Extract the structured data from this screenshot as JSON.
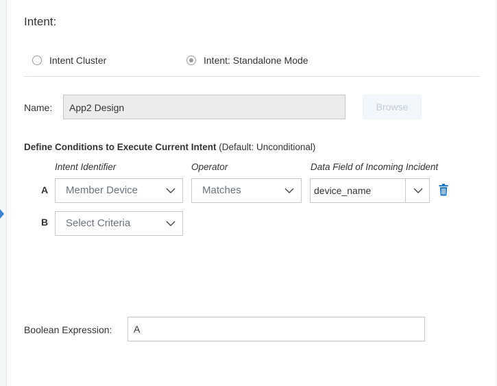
{
  "intent": {
    "title": "Intent:",
    "mode_options": [
      {
        "label": "Intent Cluster",
        "selected": false
      },
      {
        "label": "Intent: Standalone Mode",
        "selected": true
      }
    ],
    "name_label": "Name:",
    "name_value": "App2 Design",
    "browse_label": "Browse"
  },
  "conditions": {
    "heading_bold": "Define Conditions to Execute Current Intent",
    "heading_suffix": " (Default: Unconditional)",
    "columns": {
      "identifier": "Intent Identifier",
      "operator": "Operator",
      "data_field": "Data Field of Incoming Incident"
    },
    "rows": [
      {
        "letter": "A",
        "identifier": "Member Device",
        "operator": "Matches",
        "data_field": "device_name"
      },
      {
        "letter": "B",
        "identifier": "Select Criteria"
      }
    ]
  },
  "boolean": {
    "label": "Boolean Expression:",
    "value": "A"
  },
  "colors": {
    "accent": "#1f78c8",
    "disabled_button_text": "#c3cdd7"
  }
}
